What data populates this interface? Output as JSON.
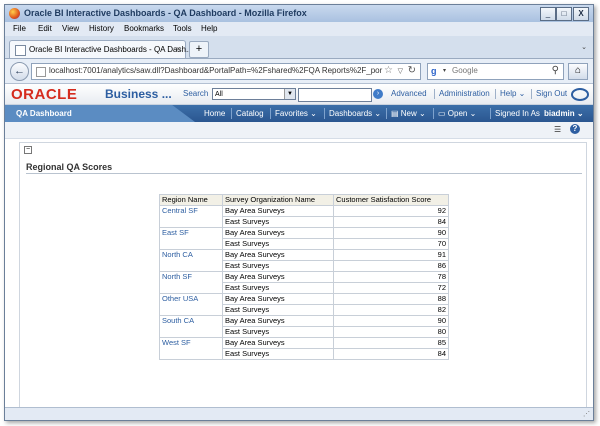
{
  "window": {
    "title": "Oracle BI Interactive Dashboards - QA Dashboard - Mozilla Firefox",
    "minimize": "_",
    "maximize": "□",
    "close": "X"
  },
  "menu": [
    "File",
    "Edit",
    "View",
    "History",
    "Bookmarks",
    "Tools",
    "Help"
  ],
  "tab": {
    "title": "Oracle BI Interactive Dashboards - QA Dash...",
    "close": "×",
    "new_tab": "+"
  },
  "nav": {
    "url": "localhost:7001/analytics/saw.dll?Dashboard&PortalPath=%2Fshared%2FQA Reports%2F_por",
    "search_placeholder": "Google"
  },
  "obi": {
    "logo": "ORACLE",
    "product": "Business ...",
    "search_label": "Search",
    "search_scope": "All",
    "links": [
      "Advanced",
      "Administration",
      "Help ⌄",
      "Sign Out"
    ],
    "bar_tab": "QA Dashboard",
    "bar_links": [
      "Home",
      "Catalog",
      "Favorites ⌄",
      "Dashboards ⌄",
      "New ⌄",
      "Open ⌄"
    ],
    "signed_in_label": "Signed In As",
    "user": "biadmin ⌄"
  },
  "report": {
    "title": "Regional QA Scores",
    "columns": [
      "Region Name",
      "Survey Organization Name",
      "Customer Satisfaction Score"
    ],
    "rows": [
      {
        "region": "Central SF",
        "surveys": [
          {
            "org": "Bay Area Surveys",
            "score": 92
          },
          {
            "org": "East Surveys",
            "score": 84
          }
        ]
      },
      {
        "region": "East SF",
        "surveys": [
          {
            "org": "Bay Area Surveys",
            "score": 90
          },
          {
            "org": "East Surveys",
            "score": 70
          }
        ]
      },
      {
        "region": "North CA",
        "surveys": [
          {
            "org": "Bay Area Surveys",
            "score": 91
          },
          {
            "org": "East Surveys",
            "score": 86
          }
        ]
      },
      {
        "region": "North SF",
        "surveys": [
          {
            "org": "Bay Area Surveys",
            "score": 78
          },
          {
            "org": "East Surveys",
            "score": 72
          }
        ]
      },
      {
        "region": "Other USA",
        "surveys": [
          {
            "org": "Bay Area Surveys",
            "score": 88
          },
          {
            "org": "East Surveys",
            "score": 82
          }
        ]
      },
      {
        "region": "South CA",
        "surveys": [
          {
            "org": "Bay Area Surveys",
            "score": 90
          },
          {
            "org": "East Surveys",
            "score": 80
          }
        ]
      },
      {
        "region": "West SF",
        "surveys": [
          {
            "org": "Bay Area Surveys",
            "score": 85
          },
          {
            "org": "East Surveys",
            "score": 84
          }
        ]
      }
    ]
  },
  "colors": {
    "oracle_red": "#d52b1e",
    "obi_blue": "#2d5ea1",
    "bar_blue": "#2a5690",
    "header_cell": "#f2f0e6"
  }
}
